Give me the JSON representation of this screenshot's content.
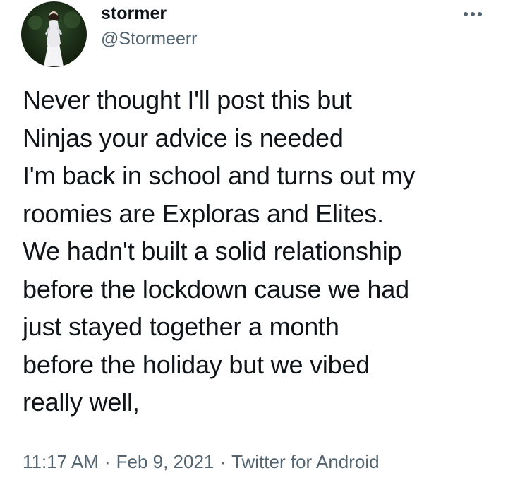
{
  "user": {
    "display_name": "stormer",
    "handle": "@Stormeerr",
    "avatar_icon": "profile-photo"
  },
  "more_icon": "more-horizontal-icon",
  "tweet": {
    "lines": [
      "Never thought I'll post this but",
      "Ninjas your advice is needed",
      "I'm back in school and turns out my",
      "roomies are Exploras and Elites.",
      "We hadn't built a solid relationship",
      "before the lockdown cause we had",
      "just stayed together a month",
      "before the holiday but we vibed",
      "really well,"
    ]
  },
  "meta": {
    "time": "11:17 AM",
    "separator": "·",
    "date": "Feb 9, 2021",
    "source": "Twitter for Android"
  },
  "colors": {
    "text_primary": "#0f1419",
    "text_secondary": "#536471",
    "background": "#ffffff"
  }
}
